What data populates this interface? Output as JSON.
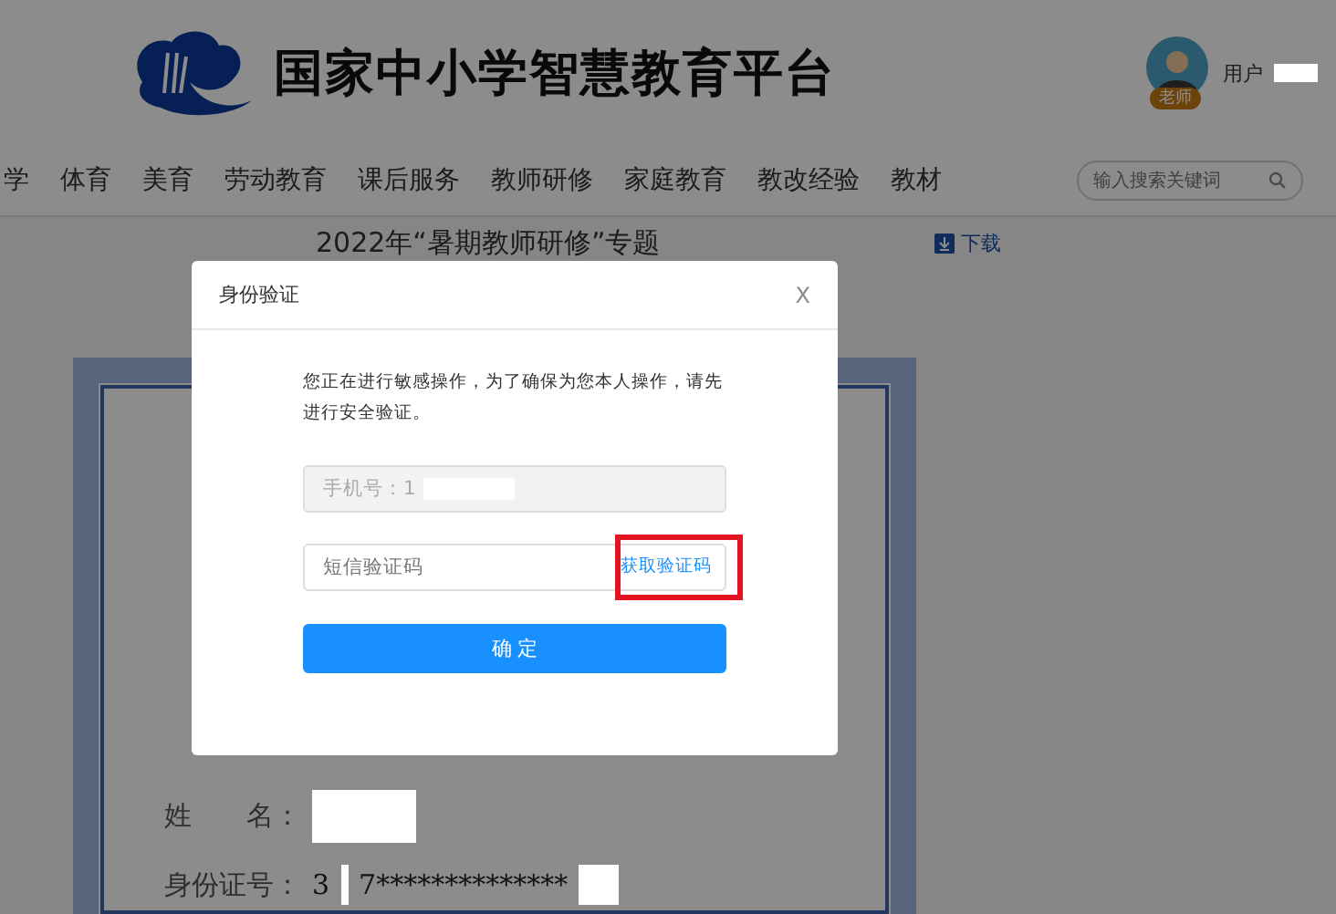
{
  "header": {
    "site_title": "国家中小学智慧教育平台",
    "user_label": "用户",
    "role_badge": "老师"
  },
  "nav": {
    "items": [
      "学",
      "体育",
      "美育",
      "劳动教育",
      "课后服务",
      "教师研修",
      "家庭教育",
      "教改经验",
      "教材"
    ],
    "search": {
      "placeholder": "输入搜索关键词"
    }
  },
  "content": {
    "title": "2022年“暑期教师研修”专题",
    "download": "下载"
  },
  "certificate": {
    "fields": [
      {
        "label": "姓　　名："
      },
      {
        "label": "身份证号：",
        "value_parts": [
          "3",
          "7**************"
        ]
      }
    ]
  },
  "dialog": {
    "title": "身份验证",
    "close": "X",
    "message": "您正在进行敏感操作，为了确保为您本人操作，请先进行安全验证。",
    "phone_field": {
      "value": "手机号：1",
      "disabled": true
    },
    "code_field": {
      "placeholder": "短信验证码"
    },
    "code_link": {
      "label": "获取验证码",
      "highlighted": true
    },
    "confirm": "确 定"
  }
}
